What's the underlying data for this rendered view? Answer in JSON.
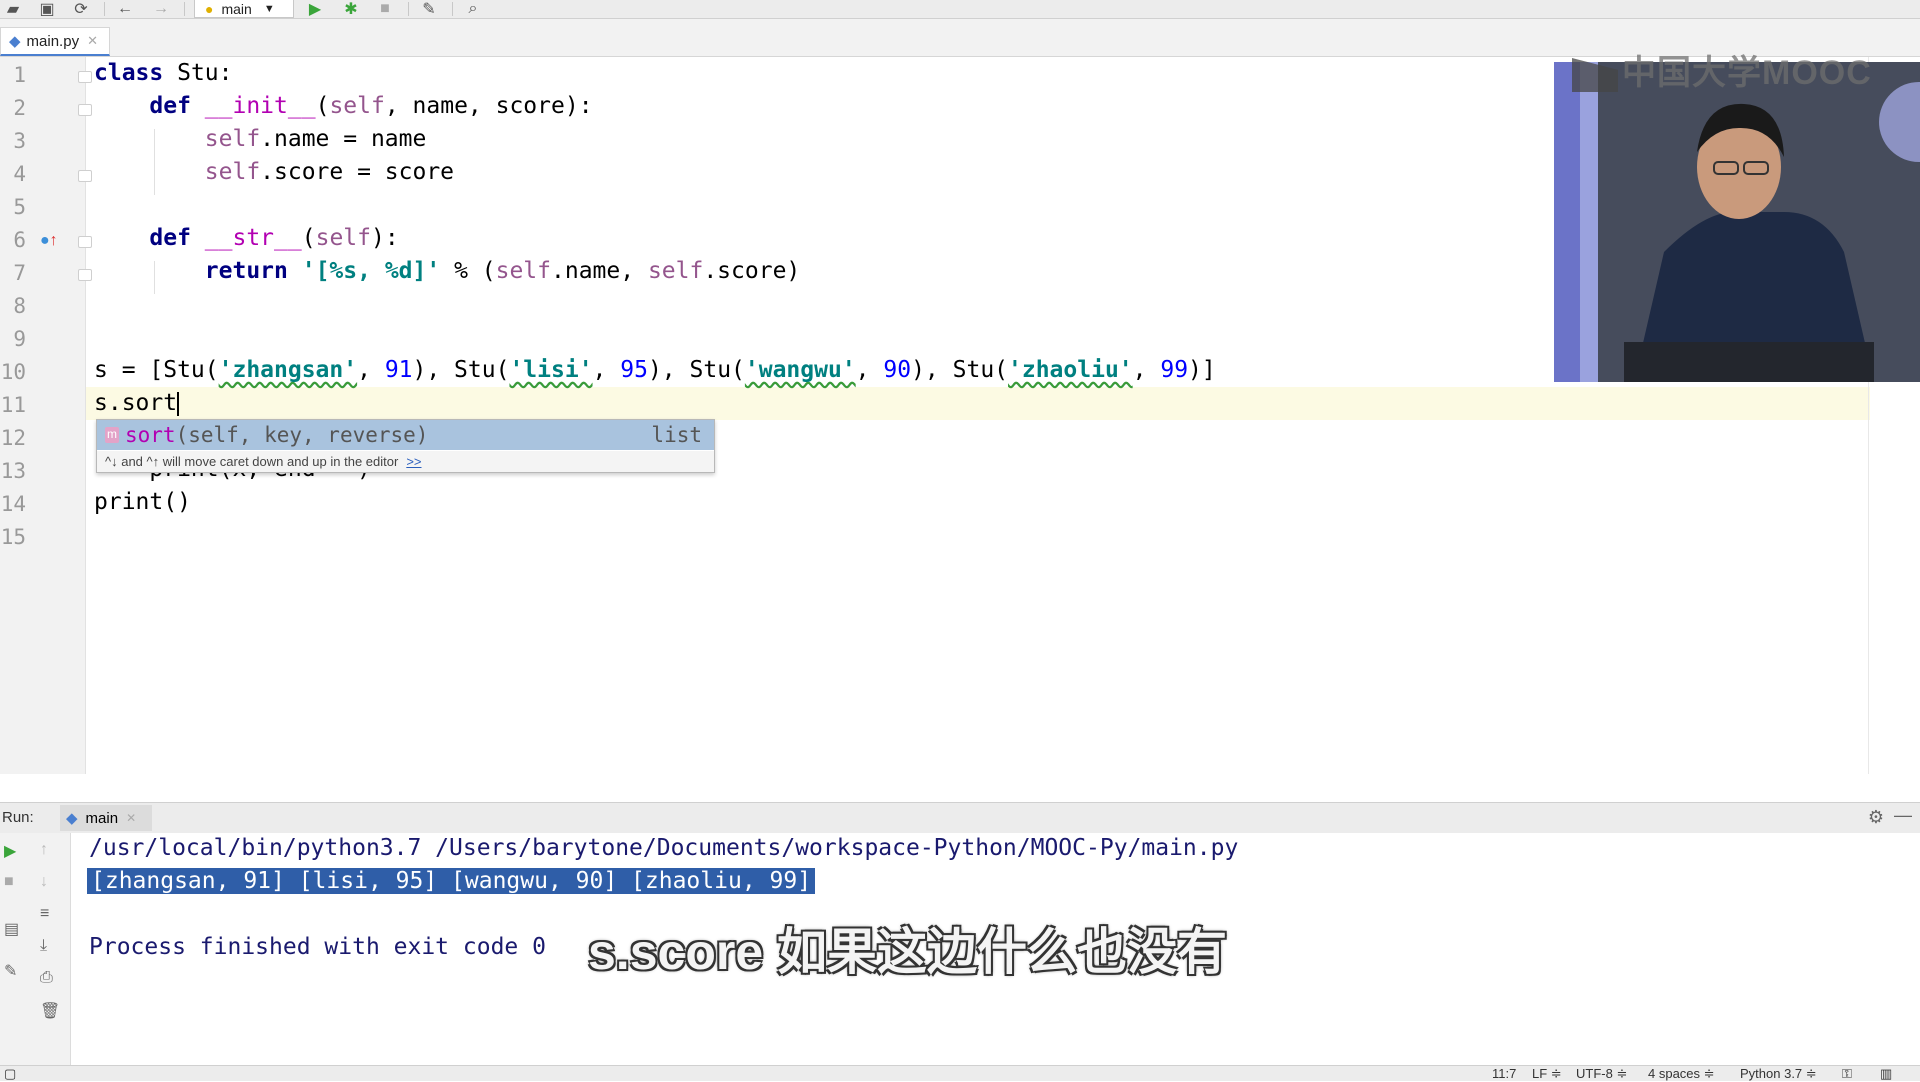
{
  "toolbar": {
    "run_config": "main",
    "icons": [
      "open-icon",
      "save-icon",
      "sync-icon",
      "back-icon",
      "forward-icon",
      "run-icon",
      "debug-icon",
      "stop-icon",
      "settings-wrench-icon",
      "search-icon"
    ]
  },
  "tabs": [
    {
      "label": "main.py"
    }
  ],
  "editor": {
    "line_numbers": [
      "1",
      "2",
      "3",
      "4",
      "5",
      "6",
      "7",
      "8",
      "9",
      "10",
      "11",
      "12",
      "13",
      "14",
      "15"
    ],
    "lines": {
      "l1_kw": "class",
      "l1_rest": " Stu:",
      "l2_kw": "def",
      "l2_fn": "__init__",
      "l2_a": "(",
      "l2_self": "self",
      "l2_rest": ", name, score):",
      "l3_self": "self",
      "l3_rest": ".name = name",
      "l4_self": "self",
      "l4_rest": ".score = score",
      "l6_kw": "def",
      "l6_fn": "__str__",
      "l6_a": "(",
      "l6_self": "self",
      "l6_rest": "):",
      "l7_kw": "return",
      "l7_str": "'[%s, %d]'",
      "l7_mid": " % (",
      "l7_self1": "self",
      "l7_mid2": ".name, ",
      "l7_self2": "self",
      "l7_rest": ".score)",
      "l10_a": "s = [Stu(",
      "l10_s1": "'zhangsan'",
      "l10_b": ", ",
      "l10_n1": "91",
      "l10_c": "), Stu(",
      "l10_s2": "'lisi'",
      "l10_d": ", ",
      "l10_n2": "95",
      "l10_e": "), Stu(",
      "l10_s3": "'wangwu'",
      "l10_f": ", ",
      "l10_n3": "90",
      "l10_g": "), Stu(",
      "l10_s4": "'zhaoliu'",
      "l10_h": ", ",
      "l10_n4": "99",
      "l10_i": ")]",
      "l11": "s.sort",
      "l13": "    print(x, end='')",
      "l14": "print()"
    }
  },
  "completion": {
    "badge": "m",
    "name": "sort",
    "params": "(self, key, reverse)",
    "type": "list",
    "hint": "^↓ and ^↑ will move caret down and up in the editor",
    "hint_link": ">>"
  },
  "video_overlay": {
    "logo": "中国大学MOOC"
  },
  "run_panel": {
    "label": "Run:",
    "tab": "main",
    "console": [
      "/usr/local/bin/python3.7 /Users/barytone/Documents/workspace-Python/MOOC-Py/main.py",
      "[zhangsan, 91] [lisi, 95] [wangwu, 90] [zhaoliu, 99]",
      "",
      "Process finished with exit code 0"
    ]
  },
  "subtitle": "s.score 如果这边什么也没有",
  "status_bar": {
    "position": "11:7",
    "line_sep": "LF ≑",
    "encoding": "UTF-8 ≑",
    "indent": "4 spaces ≑",
    "interpreter": "Python 3.7 ≑"
  }
}
